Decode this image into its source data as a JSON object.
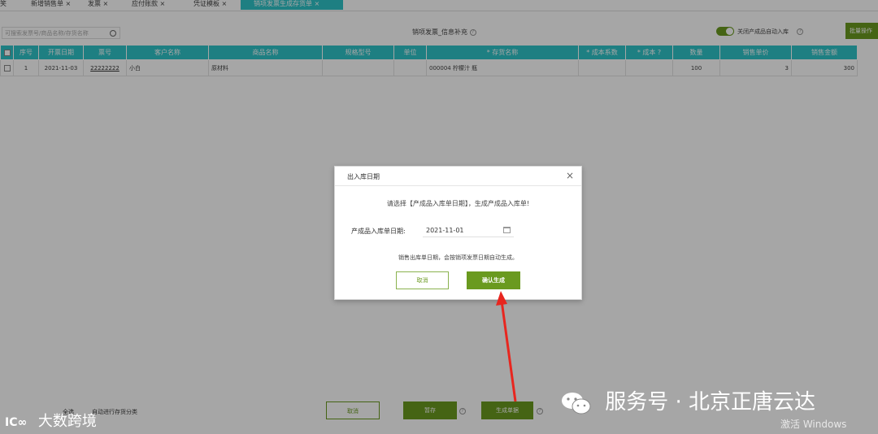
{
  "top_tabs": [
    "笑",
    "新增销售单 ×",
    "发票 ×",
    "应付账款 ×",
    "凭证模板 ×",
    "销项发票生成存货单 ×"
  ],
  "toolbar": {
    "search_placeholder": "可搜索发票号/商品名称/存货名称",
    "page_title": "销项发票_信息补充",
    "help": "?",
    "toggle_label": "关闭产成品自动入库",
    "batch_label": "批量操作"
  },
  "table": {
    "headers": [
      "",
      "序号",
      "开票日期",
      "票号",
      "客户名称",
      "商品名称",
      "规格型号",
      "单位",
      "* 存货名称",
      "* 成本系数",
      "* 成本 ?",
      "数量",
      "销售单价",
      "销售金额"
    ],
    "rows": [
      {
        "seq": "1",
        "date": "2021-11-03",
        "invoice_no": "22222222",
        "customer": "小白",
        "product": "原材料",
        "spec": "",
        "unit": "",
        "stock_name": "000004 柠檬汁 瓶",
        "cost_ratio": "",
        "cost": "",
        "qty": "100",
        "price": "3",
        "amount": "300"
      }
    ]
  },
  "bottom": {
    "check1": "全选",
    "check2": "自动进行存货分类",
    "cancel_label": "取消",
    "save_label": "暂存",
    "generate_label": "生成单据"
  },
  "dialog": {
    "title": "出入库日期",
    "close": "×",
    "prompt": "请选择【产成品入库单日期】，生成产成品入库单!",
    "field_label": "产成品入库单日期:",
    "date_value": "2021-11-01",
    "note": "销售出库单日期，会按销项发票日期自动生成。",
    "cancel_label": "取消",
    "confirm_label": "确认生成"
  },
  "watermarks": {
    "left_logo": "IC∞",
    "left_text": "大数跨境",
    "right_text": "服务号 · 北京正唐云达",
    "windows_text": "激活 Windows"
  },
  "colors": {
    "header_teal": "#2ec4c8",
    "primary_green": "#6a9a1f",
    "annotation_red": "#e8261f"
  }
}
